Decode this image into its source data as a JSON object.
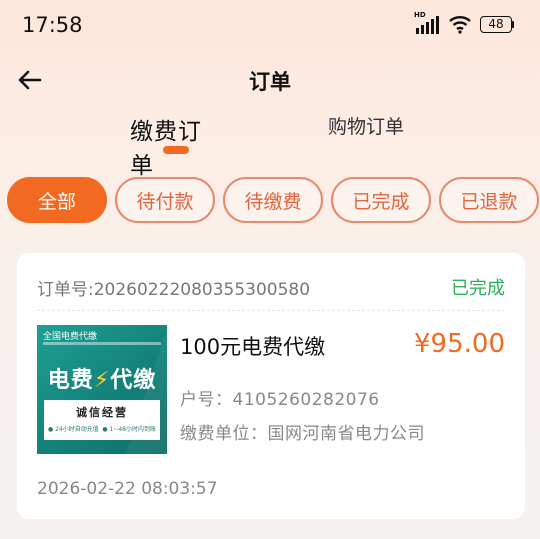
{
  "status_bar": {
    "time": "17:58",
    "network_label": "HD",
    "battery": "48"
  },
  "header": {
    "title": "订单"
  },
  "main_tabs": [
    {
      "label": "缴费订单",
      "active": true
    },
    {
      "label": "购物订单",
      "active": false
    }
  ],
  "filters": [
    {
      "label": "全部",
      "active": true
    },
    {
      "label": "待付款",
      "active": false
    },
    {
      "label": "待缴费",
      "active": false
    },
    {
      "label": "已完成",
      "active": false
    },
    {
      "label": "已退款",
      "active": false
    }
  ],
  "order": {
    "order_number": "订单号:20260222080355300580",
    "status": "已完成",
    "product_name": "100元电费代缴",
    "price": "¥95.00",
    "account": "户号：4105260282076",
    "payee": "缴费单位：国网河南省电力公司",
    "time": "2026-02-22 08:03:57",
    "image": {
      "top_text": "全国电费代缴",
      "main_text_left": "电费",
      "bolt": "⚡",
      "main_text_right": "代缴",
      "box_title": "诚信经营",
      "box_left": "● 24小时自动充值",
      "box_right": "● 1~48小时内到账"
    }
  },
  "colors": {
    "accent": "#f26a22",
    "success": "#2fae5a",
    "image_bg": "#13827a"
  }
}
